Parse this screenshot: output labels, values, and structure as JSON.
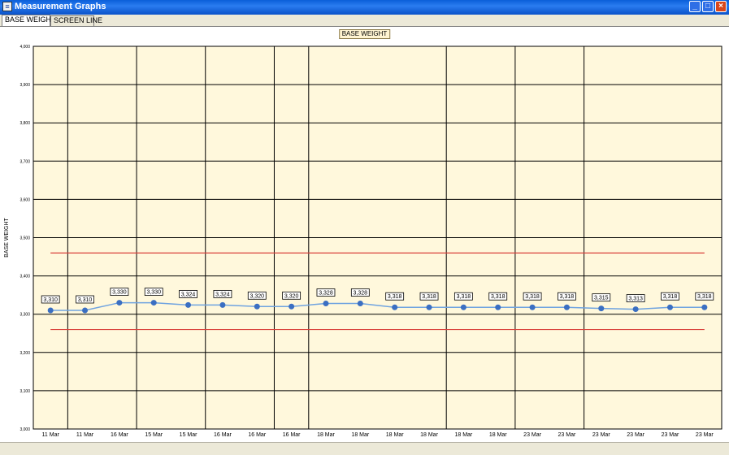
{
  "window": {
    "title": "Measurement Graphs",
    "icon": "app-icon",
    "controls": [
      "minimize-icon",
      "maximize-icon",
      "close-icon"
    ]
  },
  "tabs": [
    {
      "label": "BASE WEIGHT",
      "active": true
    },
    {
      "label": "SCREEN LINE",
      "active": false
    }
  ],
  "colors": {
    "plot_bg": "#fff8dc",
    "grid": "#000000",
    "series_line": "#6fa3e0",
    "marker": "#3b6fc2",
    "limit_line": "#d9403a"
  },
  "chart_data": {
    "type": "line",
    "title": "BASE WEIGHT",
    "ylabel": "BASE WEIGHT",
    "xlabel": "",
    "ylim": [
      3000,
      4000
    ],
    "yticks": [
      {
        "value": 3000,
        "label": "3,000"
      },
      {
        "value": 3100,
        "label": "3,100"
      },
      {
        "value": 3200,
        "label": "3,200"
      },
      {
        "value": 3300,
        "label": "3,300"
      },
      {
        "value": 3400,
        "label": "3,400"
      },
      {
        "value": 3500,
        "label": "3,500"
      },
      {
        "value": 3600,
        "label": "3,600"
      },
      {
        "value": 3700,
        "label": "3,700"
      },
      {
        "value": 3800,
        "label": "3,800"
      },
      {
        "value": 3900,
        "label": "3,900"
      },
      {
        "value": 4000,
        "label": "4,000"
      }
    ],
    "categories": [
      "11 Mar",
      "11 Mar",
      "16 Mar",
      "15 Mar",
      "15 Mar",
      "16 Mar",
      "16 Mar",
      "16 Mar",
      "18 Mar",
      "18 Mar",
      "18 Mar",
      "18 Mar",
      "18 Mar",
      "18 Mar",
      "23 Mar",
      "23 Mar",
      "23 Mar",
      "23 Mar",
      "23 Mar",
      "23 Mar"
    ],
    "values": [
      3310,
      3310,
      3330,
      3330,
      3324,
      3324,
      3320,
      3320,
      3328,
      3328,
      3318,
      3318,
      3318,
      3318,
      3318,
      3318,
      3315,
      3313,
      3318,
      3318
    ],
    "data_labels": [
      "3,310",
      "3,310",
      "3,330",
      "3,330",
      "3,324",
      "3,324",
      "3,320",
      "3,320",
      "3,328",
      "3,328",
      "3,318",
      "3,318",
      "3,318",
      "3,318",
      "3,318",
      "3,318",
      "3,315",
      "3,313",
      "3,318",
      "3,318"
    ],
    "upper_limit": 3460,
    "lower_limit": 3260,
    "group_separators_after": [
      0,
      2,
      4,
      6,
      7,
      11,
      13,
      15
    ],
    "grid": true,
    "legend": "none"
  }
}
